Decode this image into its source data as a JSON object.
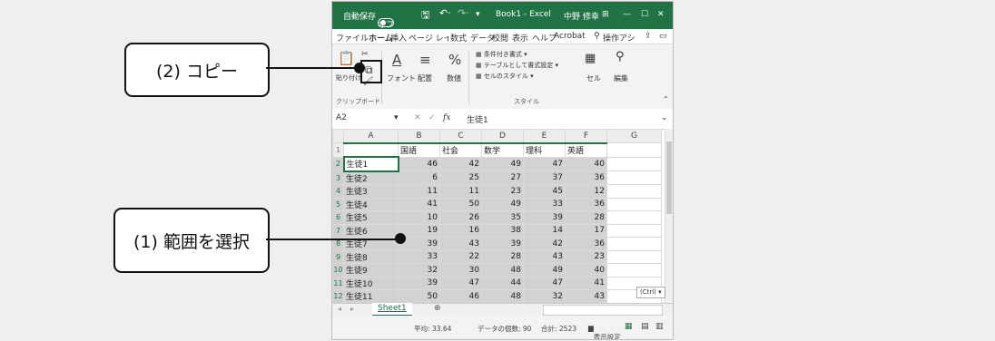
{
  "titlebar": {
    "autosave": "自動保存",
    "autosave_state": "オフ",
    "title": "Book1 - Excel",
    "user": "中野 修幸"
  },
  "menu": [
    "ファイル",
    "ホーム",
    "挿入",
    "ページ レイアウト",
    "数式",
    "データ",
    "校閲",
    "表示",
    "ヘルプ",
    "Acrobat",
    "操作アシ"
  ],
  "ribbon": {
    "paste": "貼り付け",
    "font": "フォント",
    "align": "配置",
    "number": "数値",
    "cond_format": "条件付き書式 ▾",
    "table_format": "テーブルとして書式設定 ▾",
    "cell_style": "セルのスタイル ▾",
    "cells": "セル",
    "editing": "編集",
    "clipboard_group": "クリップボード",
    "style_group": "スタイル"
  },
  "formula": {
    "namebox": "A2",
    "fx": "fx",
    "value": "生徒1"
  },
  "columns": [
    "A",
    "B",
    "C",
    "D",
    "E",
    "F",
    "G"
  ],
  "headers": [
    "",
    "国語",
    "社会",
    "数学",
    "理科",
    "英語"
  ],
  "rows": [
    {
      "n": "2",
      "name": "生徒1",
      "vals": [
        "46",
        "42",
        "49",
        "47",
        "40"
      ]
    },
    {
      "n": "3",
      "name": "生徒2",
      "vals": [
        "6",
        "25",
        "27",
        "37",
        "36"
      ]
    },
    {
      "n": "4",
      "name": "生徒3",
      "vals": [
        "11",
        "11",
        "23",
        "45",
        "12"
      ]
    },
    {
      "n": "5",
      "name": "生徒4",
      "vals": [
        "41",
        "50",
        "49",
        "33",
        "36"
      ]
    },
    {
      "n": "6",
      "name": "生徒5",
      "vals": [
        "10",
        "26",
        "35",
        "39",
        "28"
      ]
    },
    {
      "n": "7",
      "name": "生徒6",
      "vals": [
        "19",
        "16",
        "38",
        "14",
        "17"
      ]
    },
    {
      "n": "8",
      "name": "生徒7",
      "vals": [
        "39",
        "43",
        "39",
        "42",
        "36"
      ]
    },
    {
      "n": "9",
      "name": "生徒8",
      "vals": [
        "33",
        "22",
        "28",
        "43",
        "23"
      ]
    },
    {
      "n": "10",
      "name": "生徒9",
      "vals": [
        "32",
        "30",
        "48",
        "49",
        "40"
      ]
    },
    {
      "n": "11",
      "name": "生徒10",
      "vals": [
        "39",
        "47",
        "44",
        "47",
        "41"
      ]
    },
    {
      "n": "12",
      "name": "生徒11",
      "vals": [
        "50",
        "46",
        "48",
        "32",
        "43"
      ]
    }
  ],
  "sheet_tab": "Sheet1",
  "ctrl_label": "(Ctrl) ▾",
  "status": {
    "average": "平均: 33.64",
    "count": "データの個数: 90",
    "sum": "合計: 2523",
    "display": "表示設定"
  },
  "callouts": {
    "copy": "(2) コピー",
    "select": "(1) 範囲を選択"
  },
  "colors": {
    "excel_green": "#217346",
    "selection": "#d2d2d2",
    "background": "#efefef"
  }
}
